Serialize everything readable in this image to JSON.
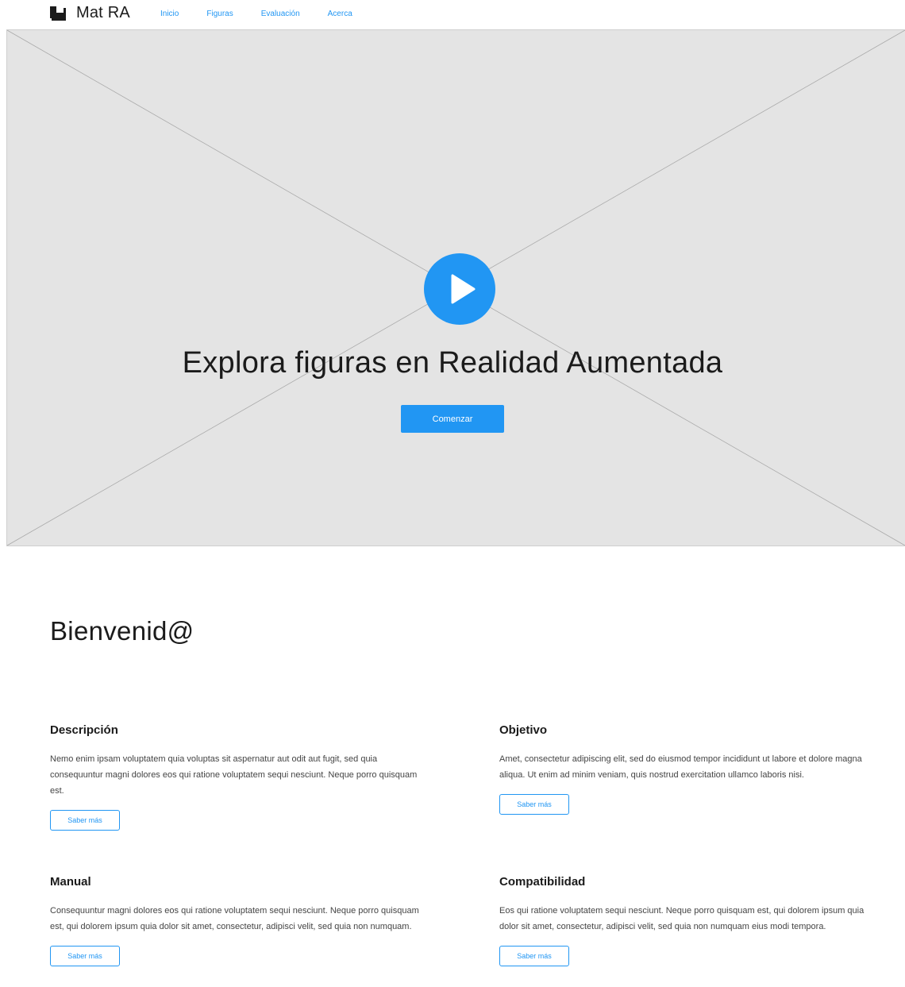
{
  "header": {
    "brand": "Mat RA",
    "brand_icon": "cube-icon",
    "nav": [
      {
        "label": "Inicio"
      },
      {
        "label": "Figuras"
      },
      {
        "label": "Evaluación"
      },
      {
        "label": "Acerca"
      }
    ]
  },
  "hero": {
    "title": "Explora figuras en Realidad Aumentada",
    "cta_label": "Comenzar",
    "play_icon": "play-icon"
  },
  "welcome": {
    "title": "Bienvenid@"
  },
  "cards": [
    {
      "title": "Descripción",
      "text": "Nemo enim ipsam voluptatem quia voluptas sit aspernatur aut odit aut fugit, sed quia consequuntur magni dolores eos qui ratione voluptatem sequi nesciunt. Neque porro quisquam est.",
      "button_label": "Saber más"
    },
    {
      "title": "Objetivo",
      "text": "Amet, consectetur adipiscing elit, sed do eiusmod tempor incididunt ut labore et dolore magna aliqua. Ut enim ad minim veniam, quis nostrud exercitation ullamco laboris nisi.",
      "button_label": "Saber más"
    },
    {
      "title": "Manual",
      "text": "Consequuntur magni dolores eos qui ratione voluptatem sequi nesciunt. Neque porro quisquam est, qui dolorem ipsum quia dolor sit amet, consectetur, adipisci velit, sed quia non numquam.",
      "button_label": "Saber más"
    },
    {
      "title": "Compatibilidad",
      "text": "Eos qui ratione voluptatem sequi nesciunt. Neque porro quisquam est, qui dolorem ipsum quia dolor sit amet, consectetur, adipisci velit, sed quia non numquam eius modi tempora.",
      "button_label": "Saber más"
    }
  ],
  "colors": {
    "accent": "#2196f3",
    "placeholder_bg": "#e4e4e4",
    "text": "#1b1b1b"
  }
}
